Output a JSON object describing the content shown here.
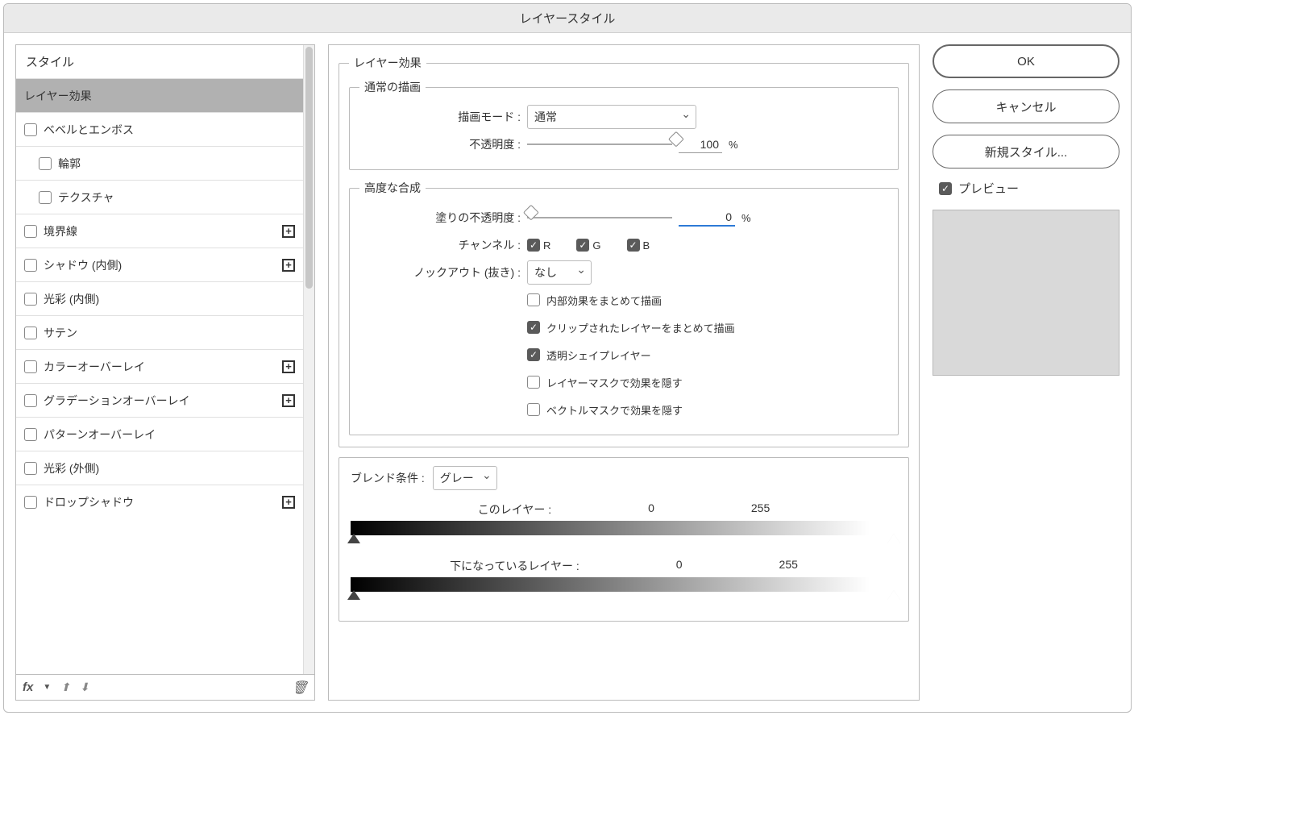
{
  "title": "レイヤースタイル",
  "styles_header": "スタイル",
  "styles": [
    {
      "label": "レイヤー効果",
      "selected": true,
      "hasCheck": false
    },
    {
      "label": "ベベルとエンボス",
      "hasCheck": true,
      "hasPlus": false
    },
    {
      "label": "輪郭",
      "sub": true,
      "hasCheck": true
    },
    {
      "label": "テクスチャ",
      "sub": true,
      "hasCheck": true
    },
    {
      "label": "境界線",
      "hasCheck": true,
      "hasPlus": true
    },
    {
      "label": "シャドウ (内側)",
      "hasCheck": true,
      "hasPlus": true
    },
    {
      "label": "光彩 (内側)",
      "hasCheck": true
    },
    {
      "label": "サテン",
      "hasCheck": true
    },
    {
      "label": "カラーオーバーレイ",
      "hasCheck": true,
      "hasPlus": true
    },
    {
      "label": "グラデーションオーバーレイ",
      "hasCheck": true,
      "hasPlus": true
    },
    {
      "label": "パターンオーバーレイ",
      "hasCheck": true
    },
    {
      "label": "光彩 (外側)",
      "hasCheck": true
    },
    {
      "label": "ドロップシャドウ",
      "hasCheck": true,
      "hasPlus": true
    }
  ],
  "fx_label": "fx",
  "effects_section": "レイヤー効果",
  "normal_draw": {
    "title": "通常の描画",
    "blend_mode_label": "描画モード :",
    "blend_mode_value": "通常",
    "opacity_label": "不透明度 :",
    "opacity_value": "100",
    "opacity_unit": "%"
  },
  "advanced": {
    "title": "高度な合成",
    "fill_opacity_label": "塗りの不透明度 :",
    "fill_opacity_value": "0",
    "fill_opacity_unit": "%",
    "channel_label": "チャンネル :",
    "chan_r": "R",
    "chan_g": "G",
    "chan_b": "B",
    "knockout_label": "ノックアウト (抜き) :",
    "knockout_value": "なし",
    "opt_internal": "内部効果をまとめて描画",
    "opt_clip": "クリップされたレイヤーをまとめて描画",
    "opt_trans": "透明シェイプレイヤー",
    "opt_layermask": "レイヤーマスクで効果を隠す",
    "opt_vectormask": "ベクトルマスクで効果を隠す"
  },
  "blendif": {
    "label": "ブレンド条件 :",
    "channel": "グレー",
    "this_layer_label": "このレイヤー :",
    "this_low": "0",
    "this_high": "255",
    "under_layer_label": "下になっているレイヤー :",
    "under_low": "0",
    "under_high": "255"
  },
  "buttons": {
    "ok": "OK",
    "cancel": "キャンセル",
    "new_style": "新規スタイル..."
  },
  "preview_label": "プレビュー"
}
